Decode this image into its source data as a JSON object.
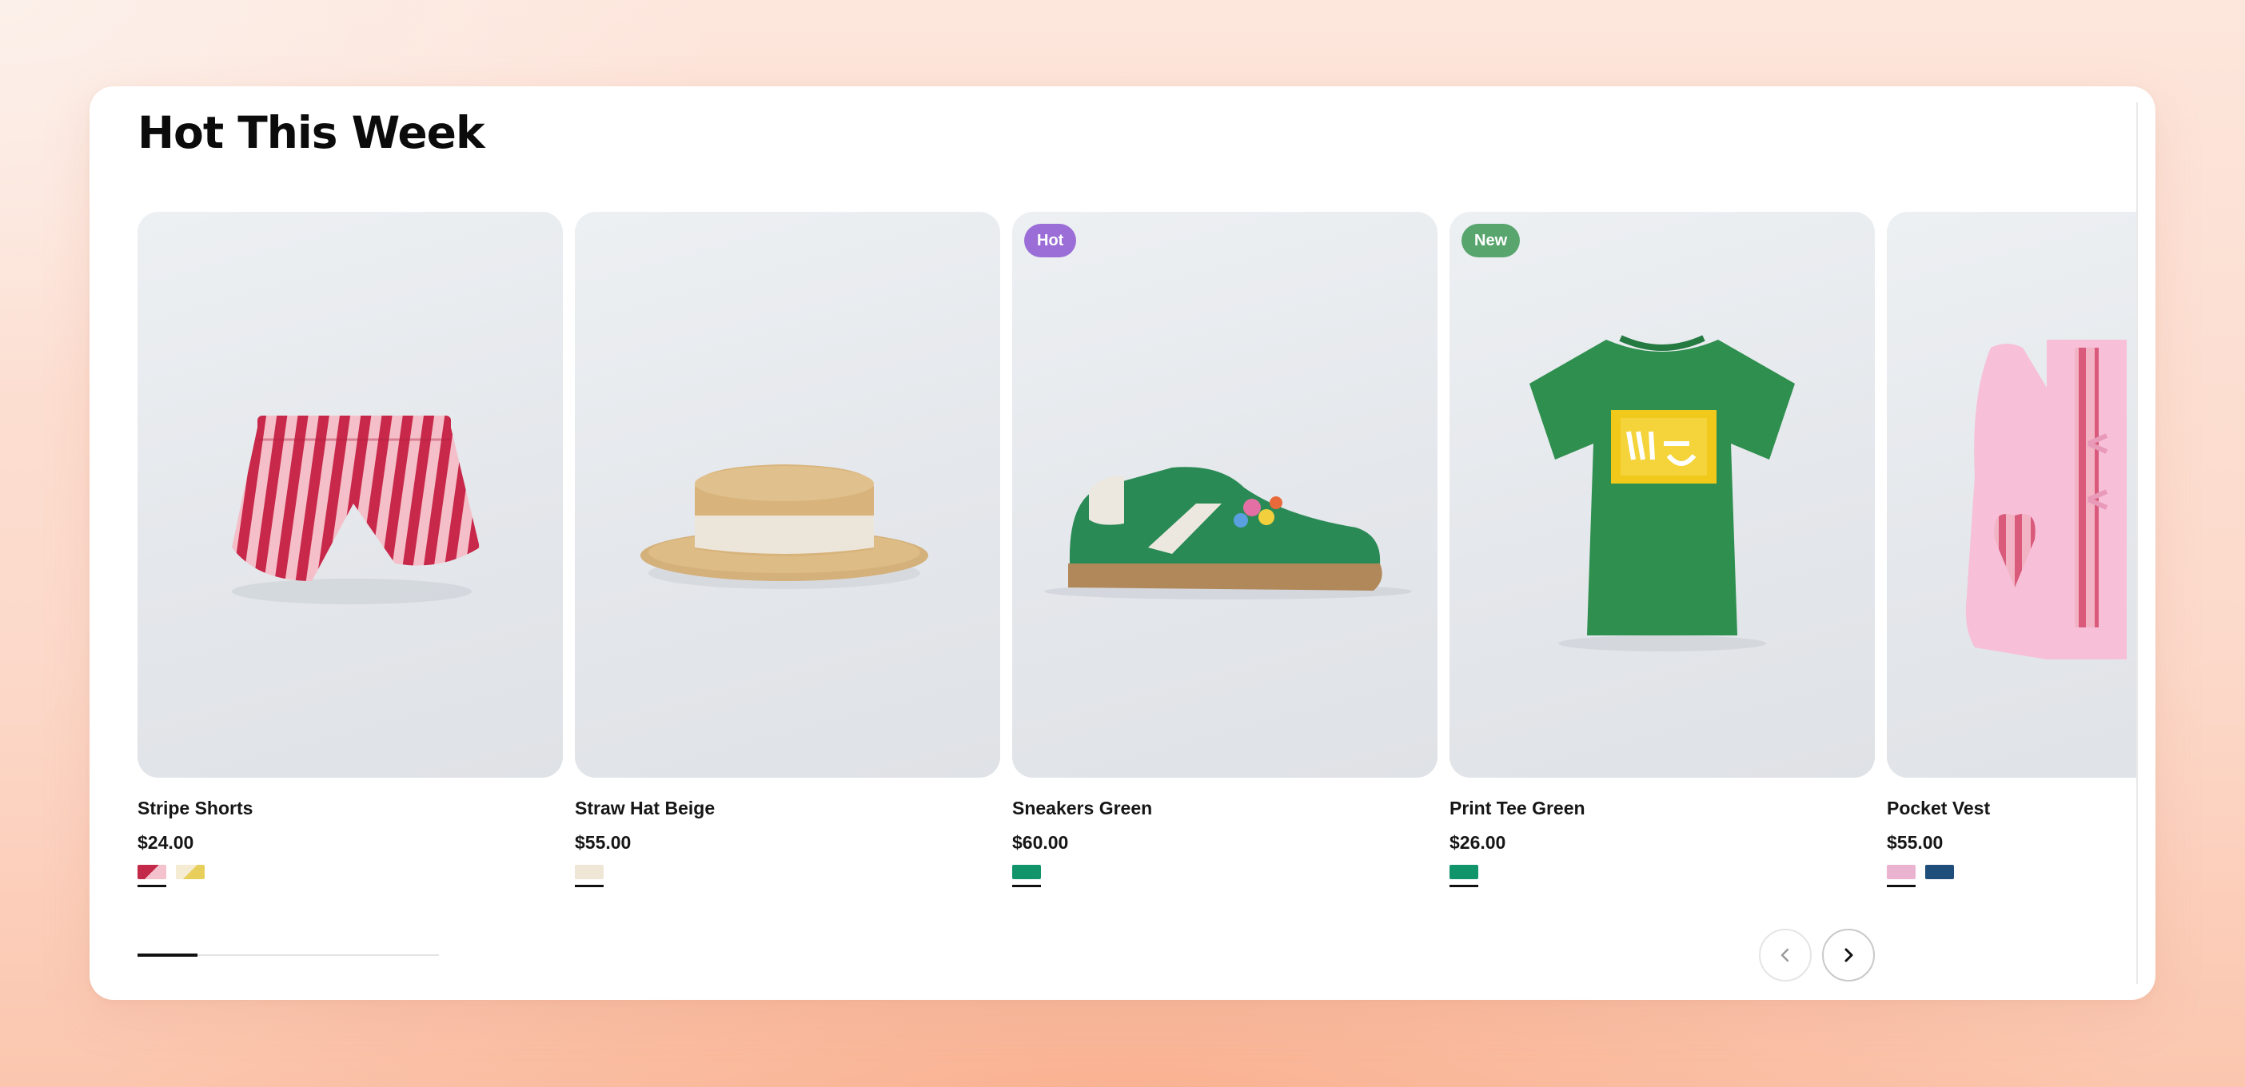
{
  "section": {
    "title": "Hot This Week"
  },
  "products": [
    {
      "name": "Stripe Shorts",
      "price": "$24.00",
      "badge": "",
      "image_icon": "striped-shorts-image",
      "swatches": [
        {
          "color": "linear-gradient(135deg, #c32a4a 0%, #c32a4a 50%, #f3c2cc 50%, #f3c2cc 100%)",
          "selected": true
        },
        {
          "color": "linear-gradient(135deg, #f5ecd3 0%, #f5ecd3 50%, #e8cf5c 50%, #e8cf5c 100%)",
          "selected": false
        }
      ]
    },
    {
      "name": "Straw Hat Beige",
      "price": "$55.00",
      "badge": "",
      "image_icon": "straw-hat-image",
      "swatches": [
        {
          "color": "#efe6d5",
          "selected": true
        }
      ]
    },
    {
      "name": "Sneakers Green",
      "price": "$60.00",
      "badge": "Hot",
      "badge_style": "hot",
      "image_icon": "sneaker-image",
      "swatches": [
        {
          "color": "#12946a",
          "selected": true
        }
      ]
    },
    {
      "name": "Print Tee Green",
      "price": "$26.00",
      "badge": "New",
      "badge_style": "new",
      "image_icon": "tshirt-image",
      "swatches": [
        {
          "color": "#12946a",
          "selected": true
        }
      ]
    },
    {
      "name": "Pocket Vest",
      "price": "$55.00",
      "badge": "",
      "image_icon": "vest-image",
      "swatches": [
        {
          "color": "#eab3d0",
          "selected": true
        },
        {
          "color": "#1f4e7a",
          "selected": false
        }
      ]
    }
  ],
  "carousel": {
    "progress_fraction": 0.2,
    "prev_icon": "chevron-left-icon",
    "next_icon": "chevron-right-icon"
  },
  "colors": {
    "hot_badge": "#9a6ed6",
    "new_badge": "#58a56e",
    "text": "#161616"
  }
}
